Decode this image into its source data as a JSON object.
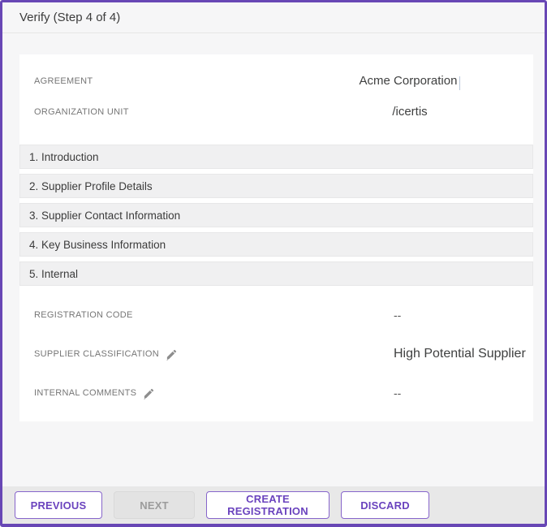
{
  "window": {
    "title": "Verify (Step 4 of 4)"
  },
  "summary_fields": {
    "agreement": {
      "label": "AGREEMENT",
      "value": "Acme Corporation"
    },
    "organization_unit": {
      "label": "ORGANIZATION UNIT",
      "value": "/icertis"
    }
  },
  "sections": [
    {
      "label": "1. Introduction"
    },
    {
      "label": "2. Supplier Profile Details"
    },
    {
      "label": "3. Supplier Contact Information"
    },
    {
      "label": "4. Key Business Information"
    },
    {
      "label": "5. Internal"
    }
  ],
  "internal_fields": [
    {
      "label": "REGISTRATION CODE",
      "value": "--",
      "editable": false
    },
    {
      "label": "SUPPLIER CLASSIFICATION",
      "value": "High Potential Supplier",
      "editable": true
    },
    {
      "label": "INTERNAL COMMENTS",
      "value": "--",
      "editable": true
    }
  ],
  "footer": {
    "previous_label": "PREVIOUS",
    "next_label": "NEXT",
    "next_disabled": true,
    "create_label": "CREATE REGISTRATION",
    "discard_label": "DISCARD"
  },
  "icons": {
    "edit": "pencil-icon"
  },
  "colors": {
    "window_border": "#6847b5",
    "accent_purple": "#6a43be",
    "button_border": "#8765cb",
    "panel_bg": "#f6f6f7",
    "card_bg": "#ffffff",
    "section_bar_bg": "#f0f0f1",
    "footer_bg": "#e8e8e8",
    "label_text": "#767676",
    "value_text": "#3f4040",
    "disabled_text": "#9c9c9c",
    "text_cursor": "#b9c7da"
  }
}
